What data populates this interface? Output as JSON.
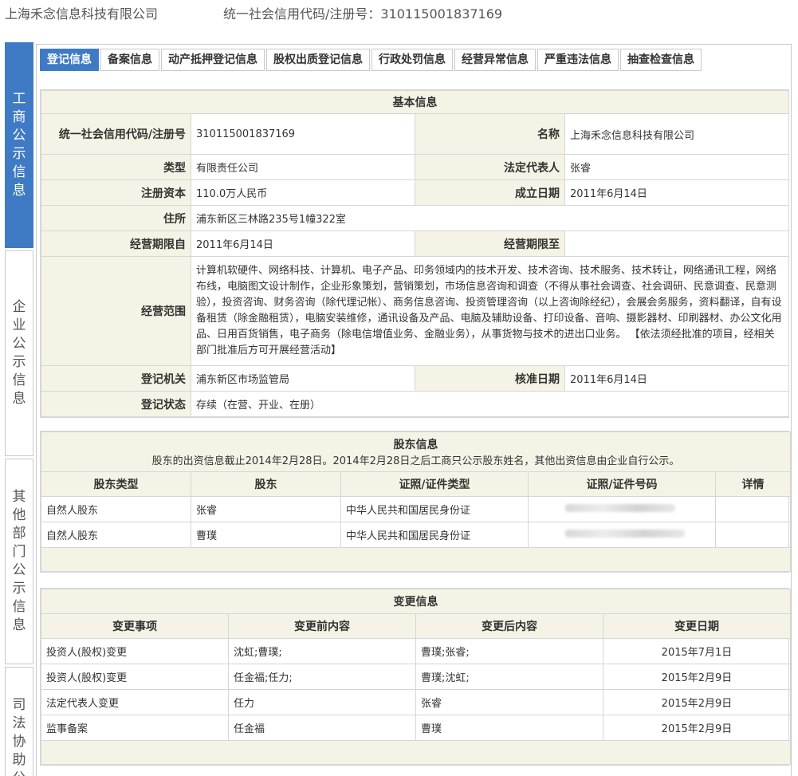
{
  "header": {
    "company_name": "上海禾念信息科技有限公司",
    "credit_code_line": "统一社会信用代码/注册号：310115001837169"
  },
  "sidebar": {
    "items": [
      {
        "label": "工商公示信息",
        "active": true
      },
      {
        "label": "企业公示信息",
        "active": false
      },
      {
        "label": "其他部门公示信息",
        "active": false
      },
      {
        "label": "司法协助公",
        "active": false
      }
    ]
  },
  "tabs": [
    {
      "label": "登记信息",
      "active": true
    },
    {
      "label": "备案信息",
      "active": false
    },
    {
      "label": "动产抵押登记信息",
      "active": false
    },
    {
      "label": "股权出质登记信息",
      "active": false
    },
    {
      "label": "行政处罚信息",
      "active": false
    },
    {
      "label": "经营异常信息",
      "active": false
    },
    {
      "label": "严重违法信息",
      "active": false
    },
    {
      "label": "抽查检查信息",
      "active": false
    }
  ],
  "basic_info": {
    "title": "基本信息",
    "credit_code_label": "统一社会信用代码/注册号",
    "credit_code": "310115001837169",
    "name_label": "名称",
    "name": "上海禾念信息科技有限公司",
    "type_label": "类型",
    "type": "有限责任公司",
    "legal_rep_label": "法定代表人",
    "legal_rep": "张睿",
    "capital_label": "注册资本",
    "capital": "110.0万人民币",
    "established_label": "成立日期",
    "established": "2011年6月14日",
    "address_label": "住所",
    "address": "浦东新区三林路235号1幢322室",
    "term_from_label": "经营期限自",
    "term_from": "2011年6月14日",
    "term_to_label": "经营期限至",
    "term_to": "",
    "scope_label": "经营范围",
    "scope": "计算机软硬件、网络科技、计算机、电子产品、印务领域内的技术开发、技术咨询、技术服务、技术转让，网络通讯工程，网络布线，电脑图文设计制作，企业形象策划，营销策划，市场信息咨询和调查（不得从事社会调查、社会调研、民意调查、民意测验），投资咨询、财务咨询（除代理记帐）、商务信息咨询、投资管理咨询（以上咨询除经纪），会展会务服务，资料翻译，自有设备租赁（除金融租赁），电脑安装维修，通讯设备及产品、电脑及辅助设备、打印设备、音响、摄影器材、印刷器材、办公文化用品、日用百货销售，电子商务（除电信增值业务、金融业务），从事货物与技术的进出口业务。 【依法须经批准的项目，经相关部门批准后方可开展经营活动】",
    "authority_label": "登记机关",
    "authority": "浦东新区市场监管局",
    "approval_date_label": "核准日期",
    "approval_date": "2011年6月14日",
    "status_label": "登记状态",
    "status": "存续（在营、开业、在册）"
  },
  "shareholders": {
    "title": "股东信息",
    "note": "股东的出资信息截止2014年2月28日。2014年2月28日之后工商只公示股东姓名，其他出资信息由企业自行公示。",
    "columns": [
      "股东类型",
      "股东",
      "证照/证件类型",
      "证照/证件号码",
      "详情"
    ],
    "rows": [
      {
        "type": "自然人股东",
        "name": "张睿",
        "id_type": "中华人民共和国居民身份证"
      },
      {
        "type": "自然人股东",
        "name": "曹璞",
        "id_type": "中华人民共和国居民身份证"
      }
    ]
  },
  "changes": {
    "title": "变更信息",
    "columns": [
      "变更事项",
      "变更前内容",
      "变更后内容",
      "变更日期"
    ],
    "rows": [
      {
        "item": "投资人(股权)变更",
        "before": "沈虹;曹璞;",
        "after": "曹璞;张睿;",
        "date": "2015年7月1日"
      },
      {
        "item": "投资人(股权)变更",
        "before": "任金福;任力;",
        "after": "曹璞;沈虹;",
        "date": "2015年2月9日"
      },
      {
        "item": "法定代表人变更",
        "before": "任力",
        "after": "张睿",
        "date": "2015年2月9日"
      },
      {
        "item": "监事备案",
        "before": "任金福",
        "after": "曹璞",
        "date": "2015年2月9日"
      }
    ]
  }
}
